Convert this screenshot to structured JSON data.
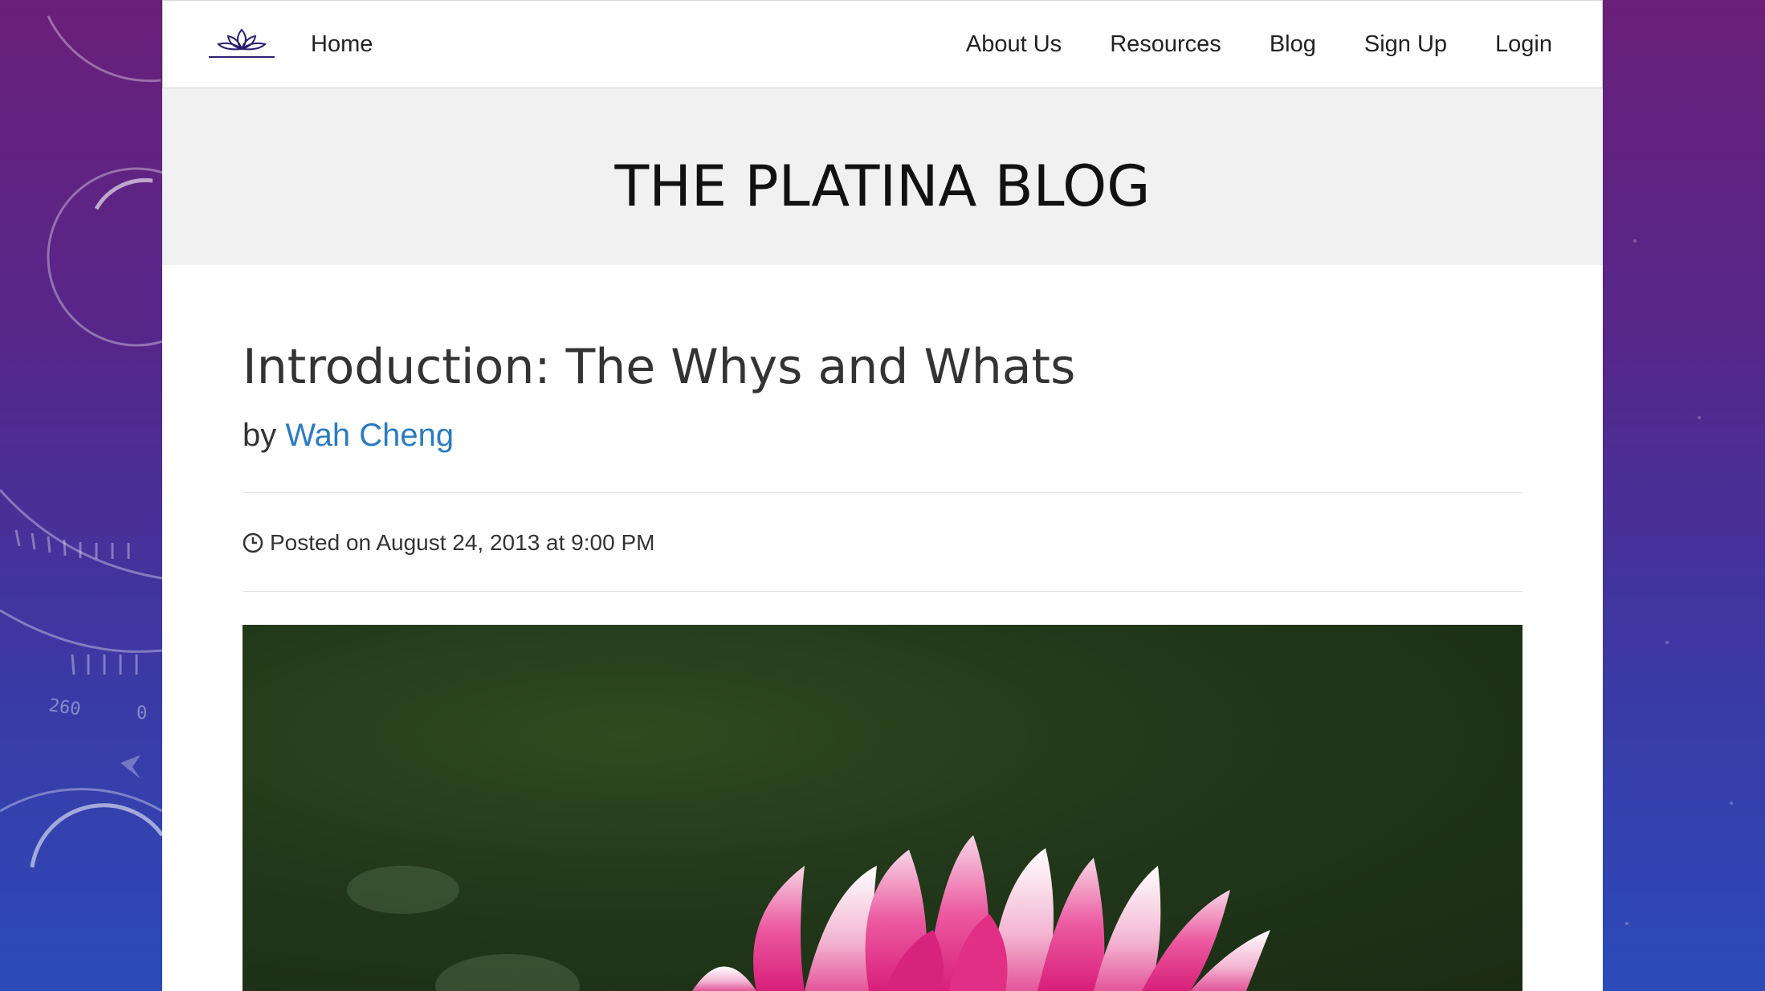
{
  "nav": {
    "home": "Home",
    "links": [
      "About Us",
      "Resources",
      "Blog",
      "Sign Up",
      "Login"
    ]
  },
  "hero": {
    "title": "THE PLATINA BLOG"
  },
  "post": {
    "title": "Introduction: The Whys and Whats",
    "by_prefix": "by",
    "author": "Wah Cheng",
    "posted": "Posted on August 24, 2013 at 9:00 PM"
  },
  "background_decor": {
    "left_labels": [
      "260",
      "0"
    ]
  },
  "colors": {
    "link": "#2c7bc0",
    "hero_bg": "#f1f1f1",
    "logo": "#2a1f6e"
  }
}
